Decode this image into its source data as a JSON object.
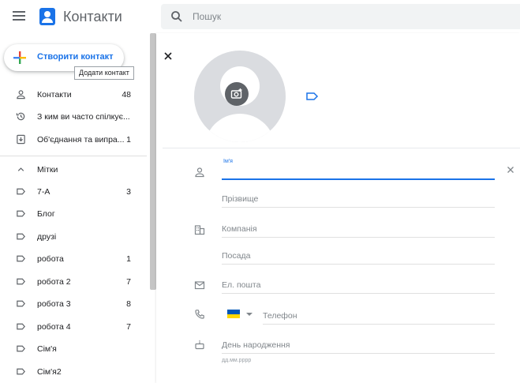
{
  "app": {
    "title": "Контакти"
  },
  "search": {
    "placeholder": "Пошук"
  },
  "sidebar": {
    "create_label": "Створити контакт",
    "tooltip": "Додати контакт",
    "items": [
      {
        "label": "Контакти",
        "count": "48",
        "icon": "person-icon"
      },
      {
        "label": "З ким ви часто спілкує...",
        "count": "",
        "icon": "history-icon"
      },
      {
        "label": "Об'єднання та випра...",
        "count": "1",
        "icon": "merge-icon"
      }
    ],
    "labels_header": "Мітки",
    "labels": [
      {
        "label": "7-А",
        "count": "3"
      },
      {
        "label": "Блог",
        "count": ""
      },
      {
        "label": "друзі",
        "count": ""
      },
      {
        "label": "робота",
        "count": "1"
      },
      {
        "label": "робота 2",
        "count": "7"
      },
      {
        "label": "робота 3",
        "count": "8"
      },
      {
        "label": "робота 4",
        "count": "7"
      },
      {
        "label": "Сім'я",
        "count": ""
      },
      {
        "label": "Сім'я2",
        "count": ""
      }
    ]
  },
  "form": {
    "first_name_label": "Ім'я",
    "first_name_value": "",
    "last_name_placeholder": "Прізвище",
    "company_placeholder": "Компанія",
    "position_placeholder": "Посада",
    "email_placeholder": "Ел. пошта",
    "phone_placeholder": "Телефон",
    "birthday_placeholder": "День народження",
    "birthday_hint": "дд.мм.рррр"
  },
  "colors": {
    "accent": "#1a73e8",
    "flag_blue": "#0057b7",
    "flag_yellow": "#ffd700"
  }
}
